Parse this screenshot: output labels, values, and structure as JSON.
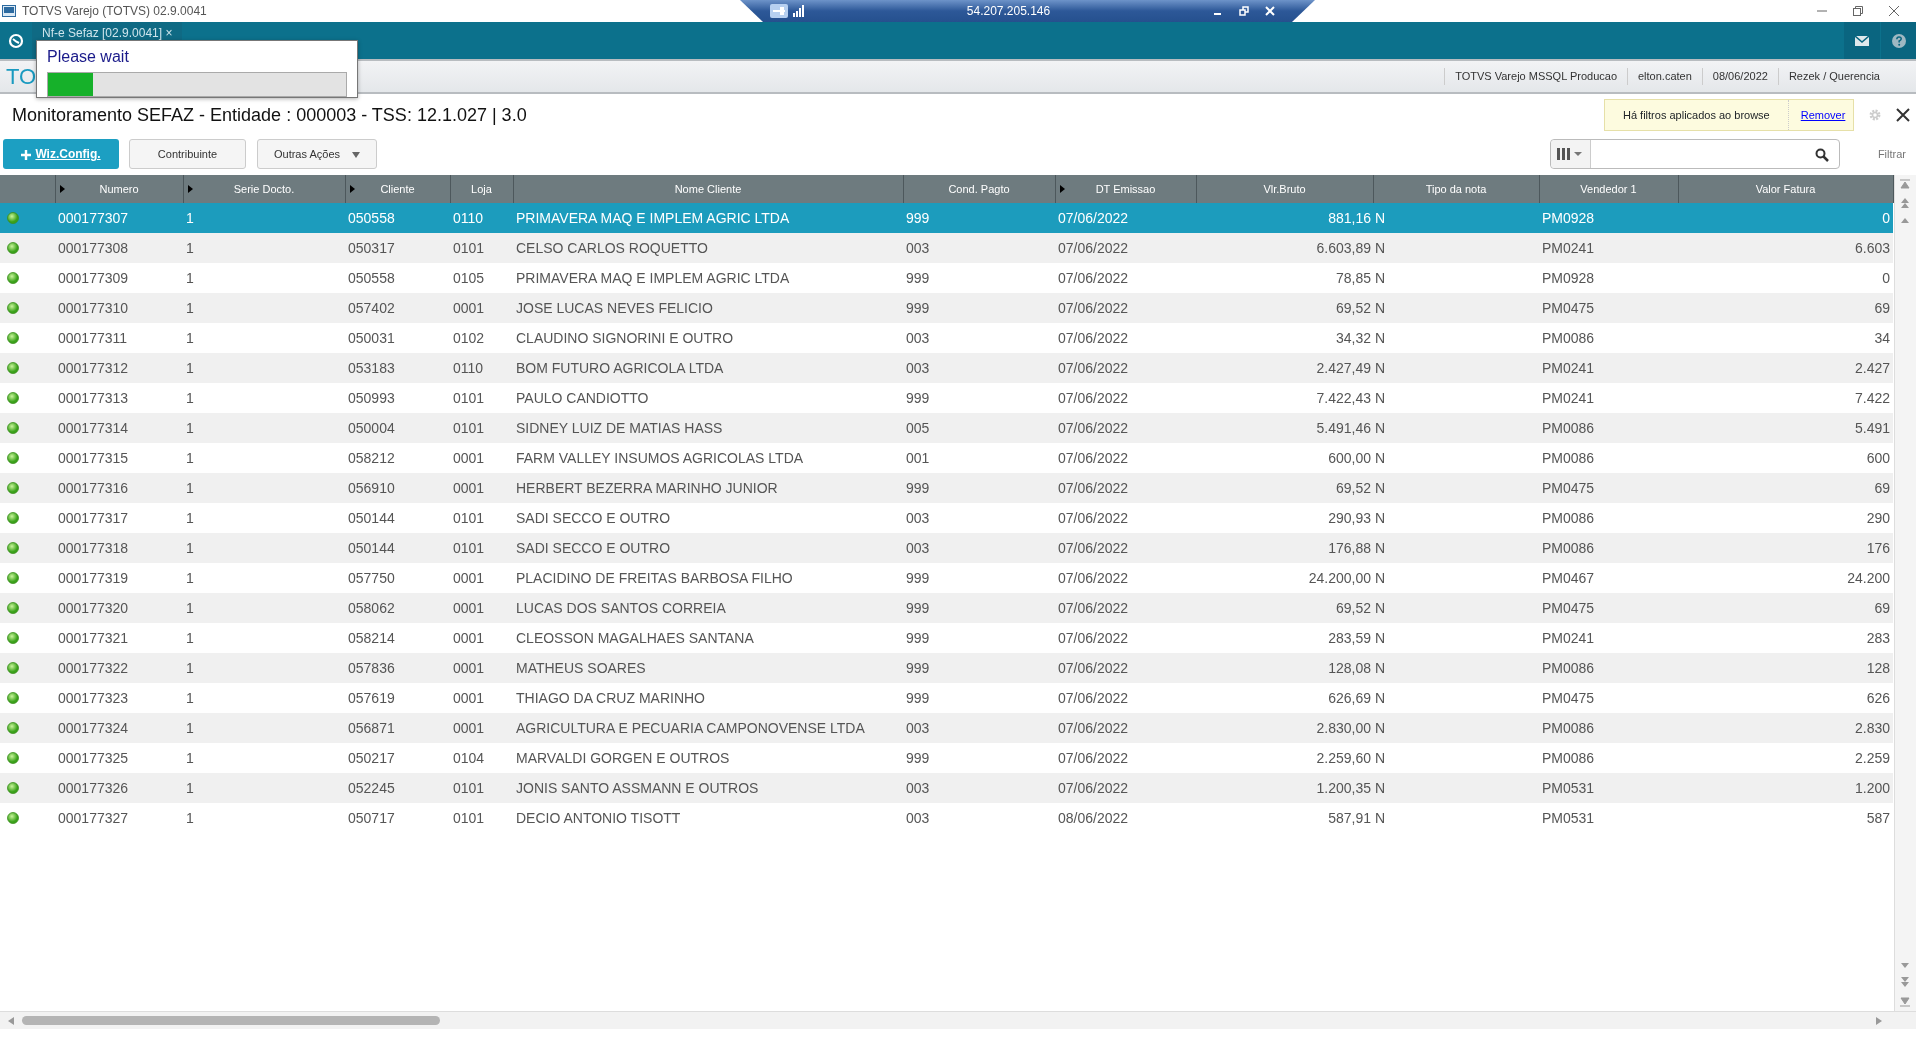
{
  "window": {
    "title": "TOTVS Varejo (TOTVS) 02.9.0041"
  },
  "remote_bar": {
    "address": "54.207.205.146"
  },
  "app_tab": {
    "label": "Nf-e Sefaz [02.9.0041]",
    "close": "×"
  },
  "logo_text": "TO",
  "info_bar": [
    "TOTVS Varejo MSSQL Producao",
    "elton.caten",
    "08/06/2022",
    "Rezek / Querencia"
  ],
  "page_title": "Monitoramento SEFAZ - Entidade : 000003 - TSS: 12.1.027 | 3.0",
  "filter_notice": {
    "text": "Há filtros aplicados ao browse",
    "link": "Remover"
  },
  "toolbar": [
    {
      "kind": "primary",
      "label": "Wiz.Config."
    },
    {
      "kind": "plain",
      "label": "Contribuinte"
    },
    {
      "kind": "dropdown",
      "label": "Outras Ações"
    }
  ],
  "search": {
    "button": "Filtrar"
  },
  "loading": {
    "title": "Please wait",
    "level": 0.15
  },
  "table": {
    "columns": [
      {
        "label": "Numero",
        "marker": true
      },
      {
        "label": "Serie Docto.",
        "marker": true
      },
      {
        "label": "Cliente",
        "marker": true
      },
      {
        "label": "Loja",
        "marker": false
      },
      {
        "label": "Nome Cliente",
        "marker": false
      },
      {
        "label": "Cond. Pagto",
        "marker": false
      },
      {
        "label": "DT Emissao",
        "marker": true
      },
      {
        "label": "Vlr.Bruto",
        "marker": false
      },
      {
        "label": "Tipo da nota",
        "marker": false
      },
      {
        "label": "Vendedor 1",
        "marker": false
      },
      {
        "label": "Valor Fatura",
        "marker": false
      }
    ],
    "rows": [
      {
        "selected": true,
        "cells": [
          "000177307",
          "1",
          "050558",
          "0110",
          "PRIMAVERA MAQ E IMPLEM AGRIC LTDA",
          "999",
          "07/06/2022",
          "881,16",
          "N",
          "PM0928",
          "0"
        ]
      },
      {
        "selected": false,
        "cells": [
          "000177308",
          "1",
          "050317",
          "0101",
          "CELSO CARLOS ROQUETTO",
          "003",
          "07/06/2022",
          "6.603,89",
          "N",
          "PM0241",
          "6.603"
        ]
      },
      {
        "selected": false,
        "cells": [
          "000177309",
          "1",
          "050558",
          "0105",
          "PRIMAVERA MAQ E IMPLEM AGRIC LTDA",
          "999",
          "07/06/2022",
          "78,85",
          "N",
          "PM0928",
          "0"
        ]
      },
      {
        "selected": false,
        "cells": [
          "000177310",
          "1",
          "057402",
          "0001",
          "JOSE LUCAS NEVES FELICIO",
          "999",
          "07/06/2022",
          "69,52",
          "N",
          "PM0475",
          "69"
        ]
      },
      {
        "selected": false,
        "cells": [
          "000177311",
          "1",
          "050031",
          "0102",
          "CLAUDINO SIGNORINI E OUTRO",
          "003",
          "07/06/2022",
          "34,32",
          "N",
          "PM0086",
          "34"
        ]
      },
      {
        "selected": false,
        "cells": [
          "000177312",
          "1",
          "053183",
          "0110",
          "BOM FUTURO AGRICOLA LTDA",
          "003",
          "07/06/2022",
          "2.427,49",
          "N",
          "PM0241",
          "2.427"
        ]
      },
      {
        "selected": false,
        "cells": [
          "000177313",
          "1",
          "050993",
          "0101",
          "PAULO CANDIOTTO",
          "999",
          "07/06/2022",
          "7.422,43",
          "N",
          "PM0241",
          "7.422"
        ]
      },
      {
        "selected": false,
        "cells": [
          "000177314",
          "1",
          "050004",
          "0101",
          "SIDNEY LUIZ DE MATIAS HASS",
          "005",
          "07/06/2022",
          "5.491,46",
          "N",
          "PM0086",
          "5.491"
        ]
      },
      {
        "selected": false,
        "cells": [
          "000177315",
          "1",
          "058212",
          "0001",
          "FARM VALLEY INSUMOS AGRICOLAS LTDA",
          "001",
          "07/06/2022",
          "600,00",
          "N",
          "PM0086",
          "600"
        ]
      },
      {
        "selected": false,
        "cells": [
          "000177316",
          "1",
          "056910",
          "0001",
          "HERBERT BEZERRA MARINHO JUNIOR",
          "999",
          "07/06/2022",
          "69,52",
          "N",
          "PM0475",
          "69"
        ]
      },
      {
        "selected": false,
        "cells": [
          "000177317",
          "1",
          "050144",
          "0101",
          "SADI SECCO E OUTRO",
          "003",
          "07/06/2022",
          "290,93",
          "N",
          "PM0086",
          "290"
        ]
      },
      {
        "selected": false,
        "cells": [
          "000177318",
          "1",
          "050144",
          "0101",
          "SADI SECCO E OUTRO",
          "003",
          "07/06/2022",
          "176,88",
          "N",
          "PM0086",
          "176"
        ]
      },
      {
        "selected": false,
        "cells": [
          "000177319",
          "1",
          "057750",
          "0001",
          "PLACIDINO DE FREITAS BARBOSA FILHO",
          "999",
          "07/06/2022",
          "24.200,00",
          "N",
          "PM0467",
          "24.200"
        ]
      },
      {
        "selected": false,
        "cells": [
          "000177320",
          "1",
          "058062",
          "0001",
          "LUCAS DOS SANTOS CORREIA",
          "999",
          "07/06/2022",
          "69,52",
          "N",
          "PM0475",
          "69"
        ]
      },
      {
        "selected": false,
        "cells": [
          "000177321",
          "1",
          "058214",
          "0001",
          "CLEOSSON MAGALHAES SANTANA",
          "999",
          "07/06/2022",
          "283,59",
          "N",
          "PM0241",
          "283"
        ]
      },
      {
        "selected": false,
        "cells": [
          "000177322",
          "1",
          "057836",
          "0001",
          "MATHEUS SOARES",
          "999",
          "07/06/2022",
          "128,08",
          "N",
          "PM0086",
          "128"
        ]
      },
      {
        "selected": false,
        "cells": [
          "000177323",
          "1",
          "057619",
          "0001",
          "THIAGO DA CRUZ MARINHO",
          "999",
          "07/06/2022",
          "626,69",
          "N",
          "PM0475",
          "626"
        ]
      },
      {
        "selected": false,
        "cells": [
          "000177324",
          "1",
          "056871",
          "0001",
          "AGRICULTURA E PECUARIA CAMPONOVENSE LTDA",
          "003",
          "07/06/2022",
          "2.830,00",
          "N",
          "PM0086",
          "2.830"
        ]
      },
      {
        "selected": false,
        "cells": [
          "000177325",
          "1",
          "050217",
          "0104",
          "MARVALDI GORGEN E OUTROS",
          "999",
          "07/06/2022",
          "2.259,60",
          "N",
          "PM0086",
          "2.259"
        ]
      },
      {
        "selected": false,
        "cells": [
          "000177326",
          "1",
          "052245",
          "0101",
          "JONIS SANTO ASSMANN E OUTROS",
          "003",
          "07/06/2022",
          "1.200,35",
          "N",
          "PM0531",
          "1.200"
        ]
      },
      {
        "selected": false,
        "cells": [
          "000177327",
          "1",
          "050717",
          "0101",
          "DECIO ANTONIO TISOTT",
          "003",
          "08/06/2022",
          "587,91",
          "N",
          "PM0531",
          "587"
        ]
      }
    ]
  }
}
